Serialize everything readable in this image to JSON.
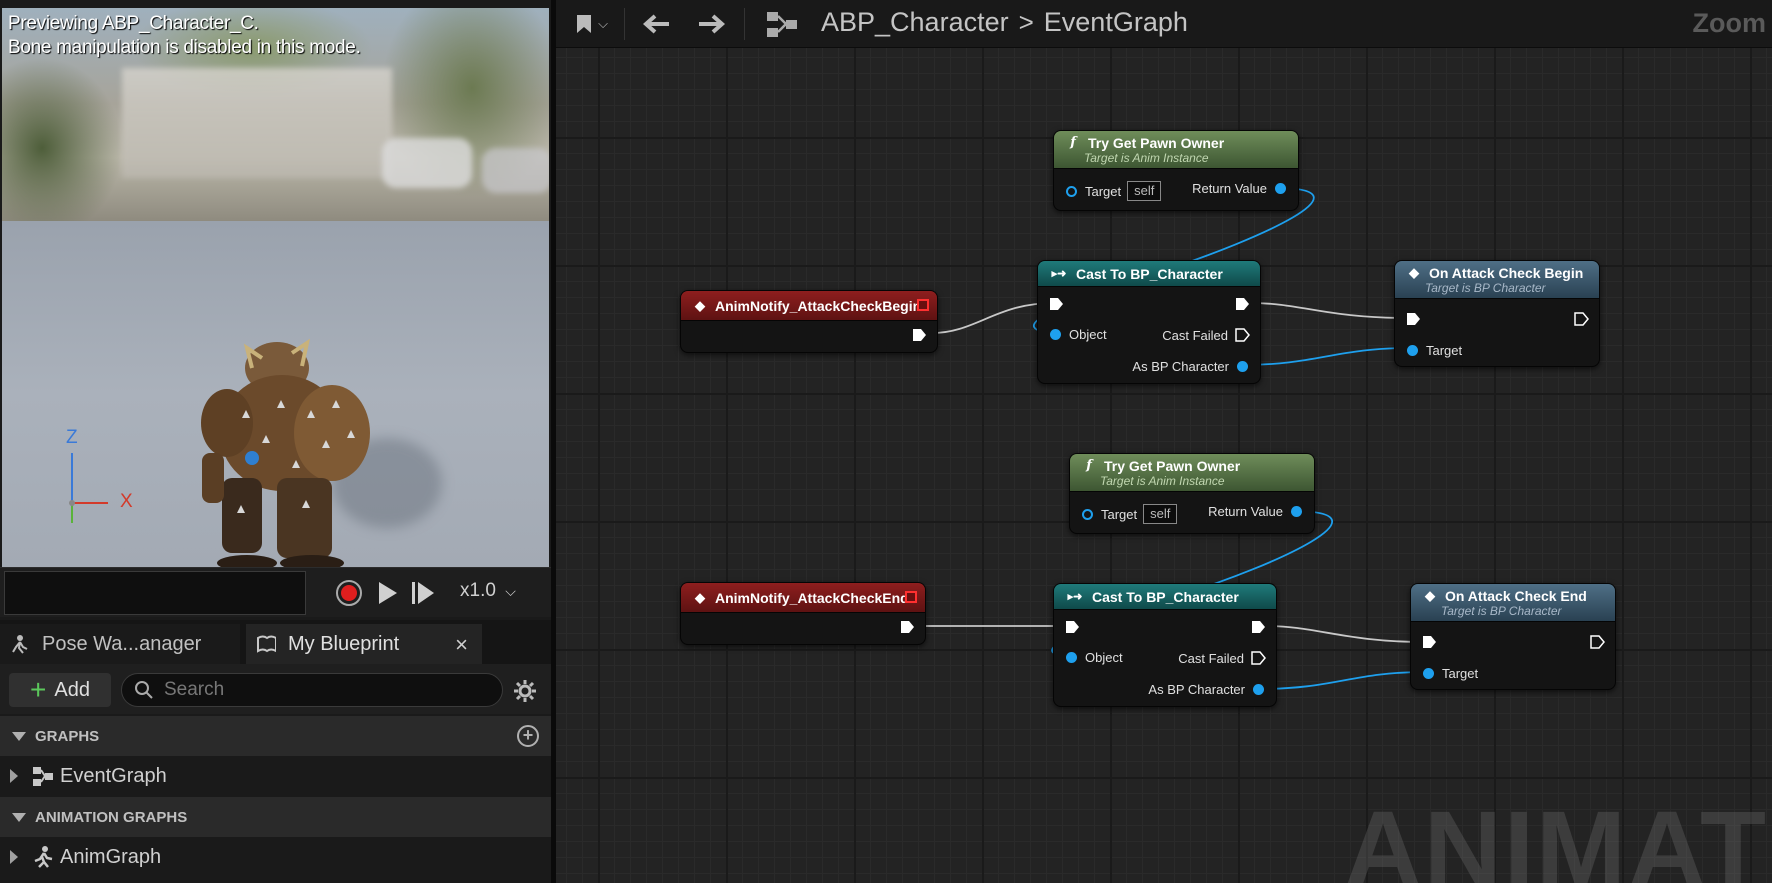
{
  "viewport": {
    "message_line1": "Previewing ABP_Character_C.",
    "message_line2": "Bone manipulation is disabled in this mode.",
    "axis_x": "X",
    "axis_z": "Z"
  },
  "timeline": {
    "speed": "x1.0"
  },
  "tabs": {
    "pose": "Pose Wa...anager",
    "blueprint": "My Blueprint",
    "close": "×"
  },
  "bp_toolbar": {
    "add_label": "Add",
    "search_placeholder": "Search"
  },
  "sections": {
    "graphs": "GRAPHS",
    "graphs_item": "EventGraph",
    "anim_graphs": "ANIMATION GRAPHS",
    "anim_graphs_item": "AnimGraph"
  },
  "graph_toolbar": {
    "crumb_root": "ABP_Character",
    "crumb_sep": ">",
    "crumb_current": "EventGraph",
    "zoom": "Zoom"
  },
  "watermark": "ANIMATION",
  "nodes": {
    "notify_begin": {
      "title": "AnimNotify_AttackCheckBegin"
    },
    "notify_end": {
      "title": "AnimNotify_AttackCheckEnd"
    },
    "pawn1": {
      "title": "Try Get Pawn Owner",
      "sub": "Target is Anim Instance",
      "target": "Target",
      "self": "self",
      "ret": "Return Value"
    },
    "pawn2": {
      "title": "Try Get Pawn Owner",
      "sub": "Target is Anim Instance",
      "target": "Target",
      "self": "self",
      "ret": "Return Value"
    },
    "cast1": {
      "title": "Cast To BP_Character",
      "object": "Object",
      "failed": "Cast Failed",
      "as": "As BP Character"
    },
    "cast2": {
      "title": "Cast To BP_Character",
      "object": "Object",
      "failed": "Cast Failed",
      "as": "As BP Character"
    },
    "call_begin": {
      "title": "On Attack Check Begin",
      "sub": "Target is BP Character",
      "target": "Target"
    },
    "call_end": {
      "title": "On Attack Check End",
      "sub": "Target is BP Character",
      "target": "Target"
    }
  },
  "colors": {
    "event_header": "#8e1e1e",
    "func_header": "#6f8d5a",
    "cast_header": "#1f7a7a",
    "call_header": "#4f6f86",
    "object_pin": "#1ea0ee"
  }
}
